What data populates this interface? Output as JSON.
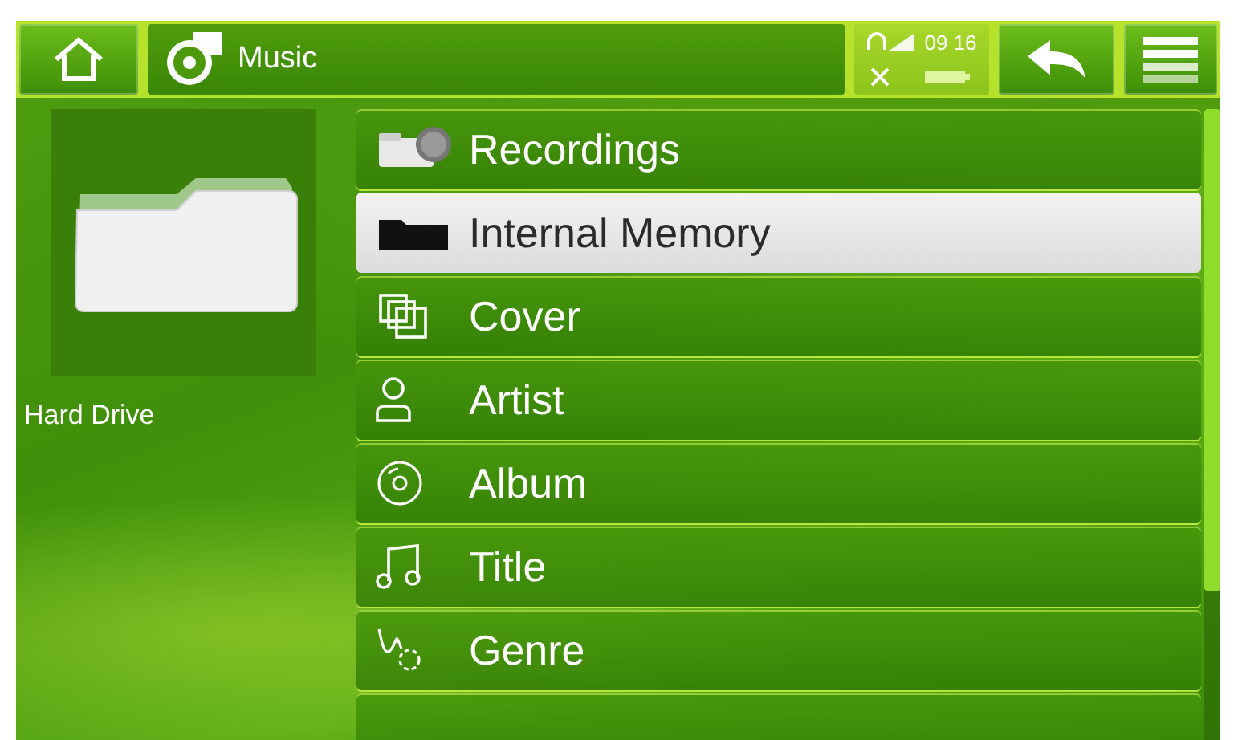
{
  "top_bar": {
    "title": "Music",
    "clock": "09 16"
  },
  "sidebar": {
    "label": "Hard Drive"
  },
  "items": [
    {
      "kind": "recordings",
      "label": "Recordings",
      "selected": false
    },
    {
      "kind": "folder",
      "label": "Internal Memory",
      "selected": true
    },
    {
      "kind": "cover",
      "label": "Cover",
      "selected": false
    },
    {
      "kind": "artist",
      "label": "Artist",
      "selected": false
    },
    {
      "kind": "album",
      "label": "Album",
      "selected": false
    },
    {
      "kind": "title",
      "label": "Title",
      "selected": false
    },
    {
      "kind": "genre",
      "label": "Genre",
      "selected": false
    }
  ]
}
